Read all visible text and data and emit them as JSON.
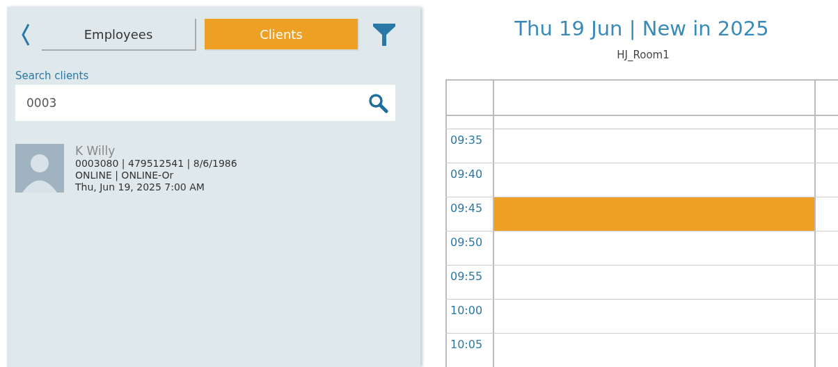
{
  "tabs": [
    {
      "label": "Employees",
      "selected": false
    },
    {
      "label": "Clients",
      "selected": true
    }
  ],
  "search": {
    "label": "Search clients",
    "value": "0003"
  },
  "results": [
    {
      "name": "K Willy",
      "details": "0003080 | 479512541 | 8/6/1986",
      "location": "ONLINE | ONLINE-Or",
      "datetime": "Thu, Jun 19, 2025 7:00 AM"
    }
  ],
  "calendar": {
    "title": "Thu 19 Jun | New in 2025",
    "resource": "HJ_Room1",
    "slots": [
      {
        "time": "09:35",
        "booked": false
      },
      {
        "time": "09:40",
        "booked": false
      },
      {
        "time": "09:45",
        "booked": true
      },
      {
        "time": "09:50",
        "booked": false
      },
      {
        "time": "09:55",
        "booked": false
      },
      {
        "time": "10:00",
        "booked": false
      },
      {
        "time": "10:05",
        "booked": false
      }
    ]
  }
}
